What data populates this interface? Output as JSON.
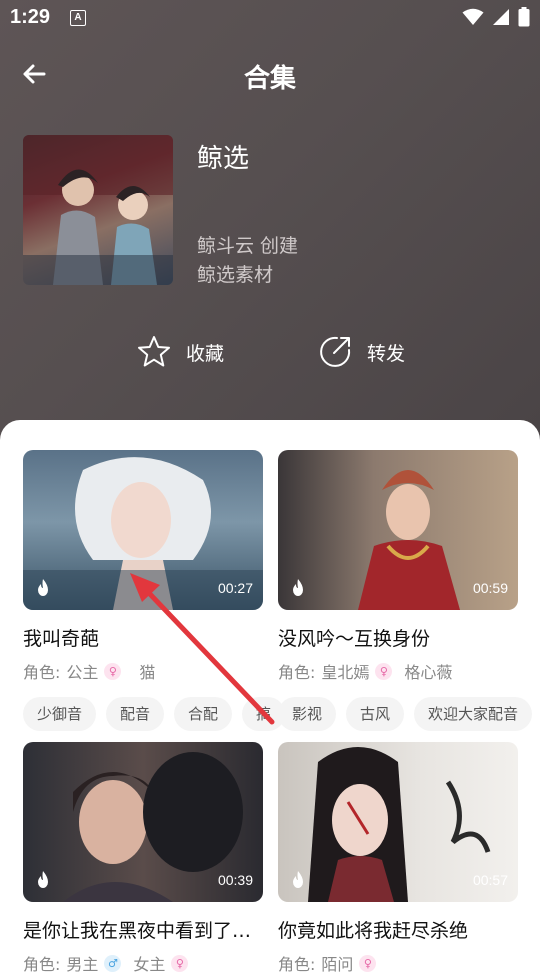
{
  "status_bar": {
    "time": "1:29",
    "notification_icon": "A"
  },
  "nav": {
    "title": "合集"
  },
  "collection": {
    "title": "鲸选",
    "creator": "鲸斗云 创建",
    "subtitle": "鲸选素材",
    "favorite_label": "收藏",
    "share_label": "转发"
  },
  "videos": [
    {
      "title": "我叫奇葩",
      "duration": "00:27",
      "role_label": "角色:",
      "roles": [
        {
          "name": "公主",
          "gender": "female"
        },
        {
          "name": "猫",
          "gender": ""
        }
      ],
      "tags": [
        "少御音",
        "配音",
        "合配",
        "搞"
      ]
    },
    {
      "title": "没风吟～互换身份",
      "duration": "00:59",
      "role_label": "角色:",
      "roles": [
        {
          "name": "皇北嫣",
          "gender": "female"
        },
        {
          "name": "格心薇",
          "gender": ""
        }
      ],
      "tags": [
        "影视",
        "古风",
        "欢迎大家配音"
      ]
    },
    {
      "title": "是你让我在黑夜中看到了…",
      "duration": "00:39",
      "role_label": "角色:",
      "roles": [
        {
          "name": "男主",
          "gender": "male"
        },
        {
          "name": "女主",
          "gender": "female"
        }
      ],
      "tags": []
    },
    {
      "title": "你竟如此将我赶尽杀绝",
      "duration": "00:57",
      "role_label": "角色:",
      "roles": [
        {
          "name": "陌问",
          "gender": "female"
        }
      ],
      "tags": []
    }
  ]
}
